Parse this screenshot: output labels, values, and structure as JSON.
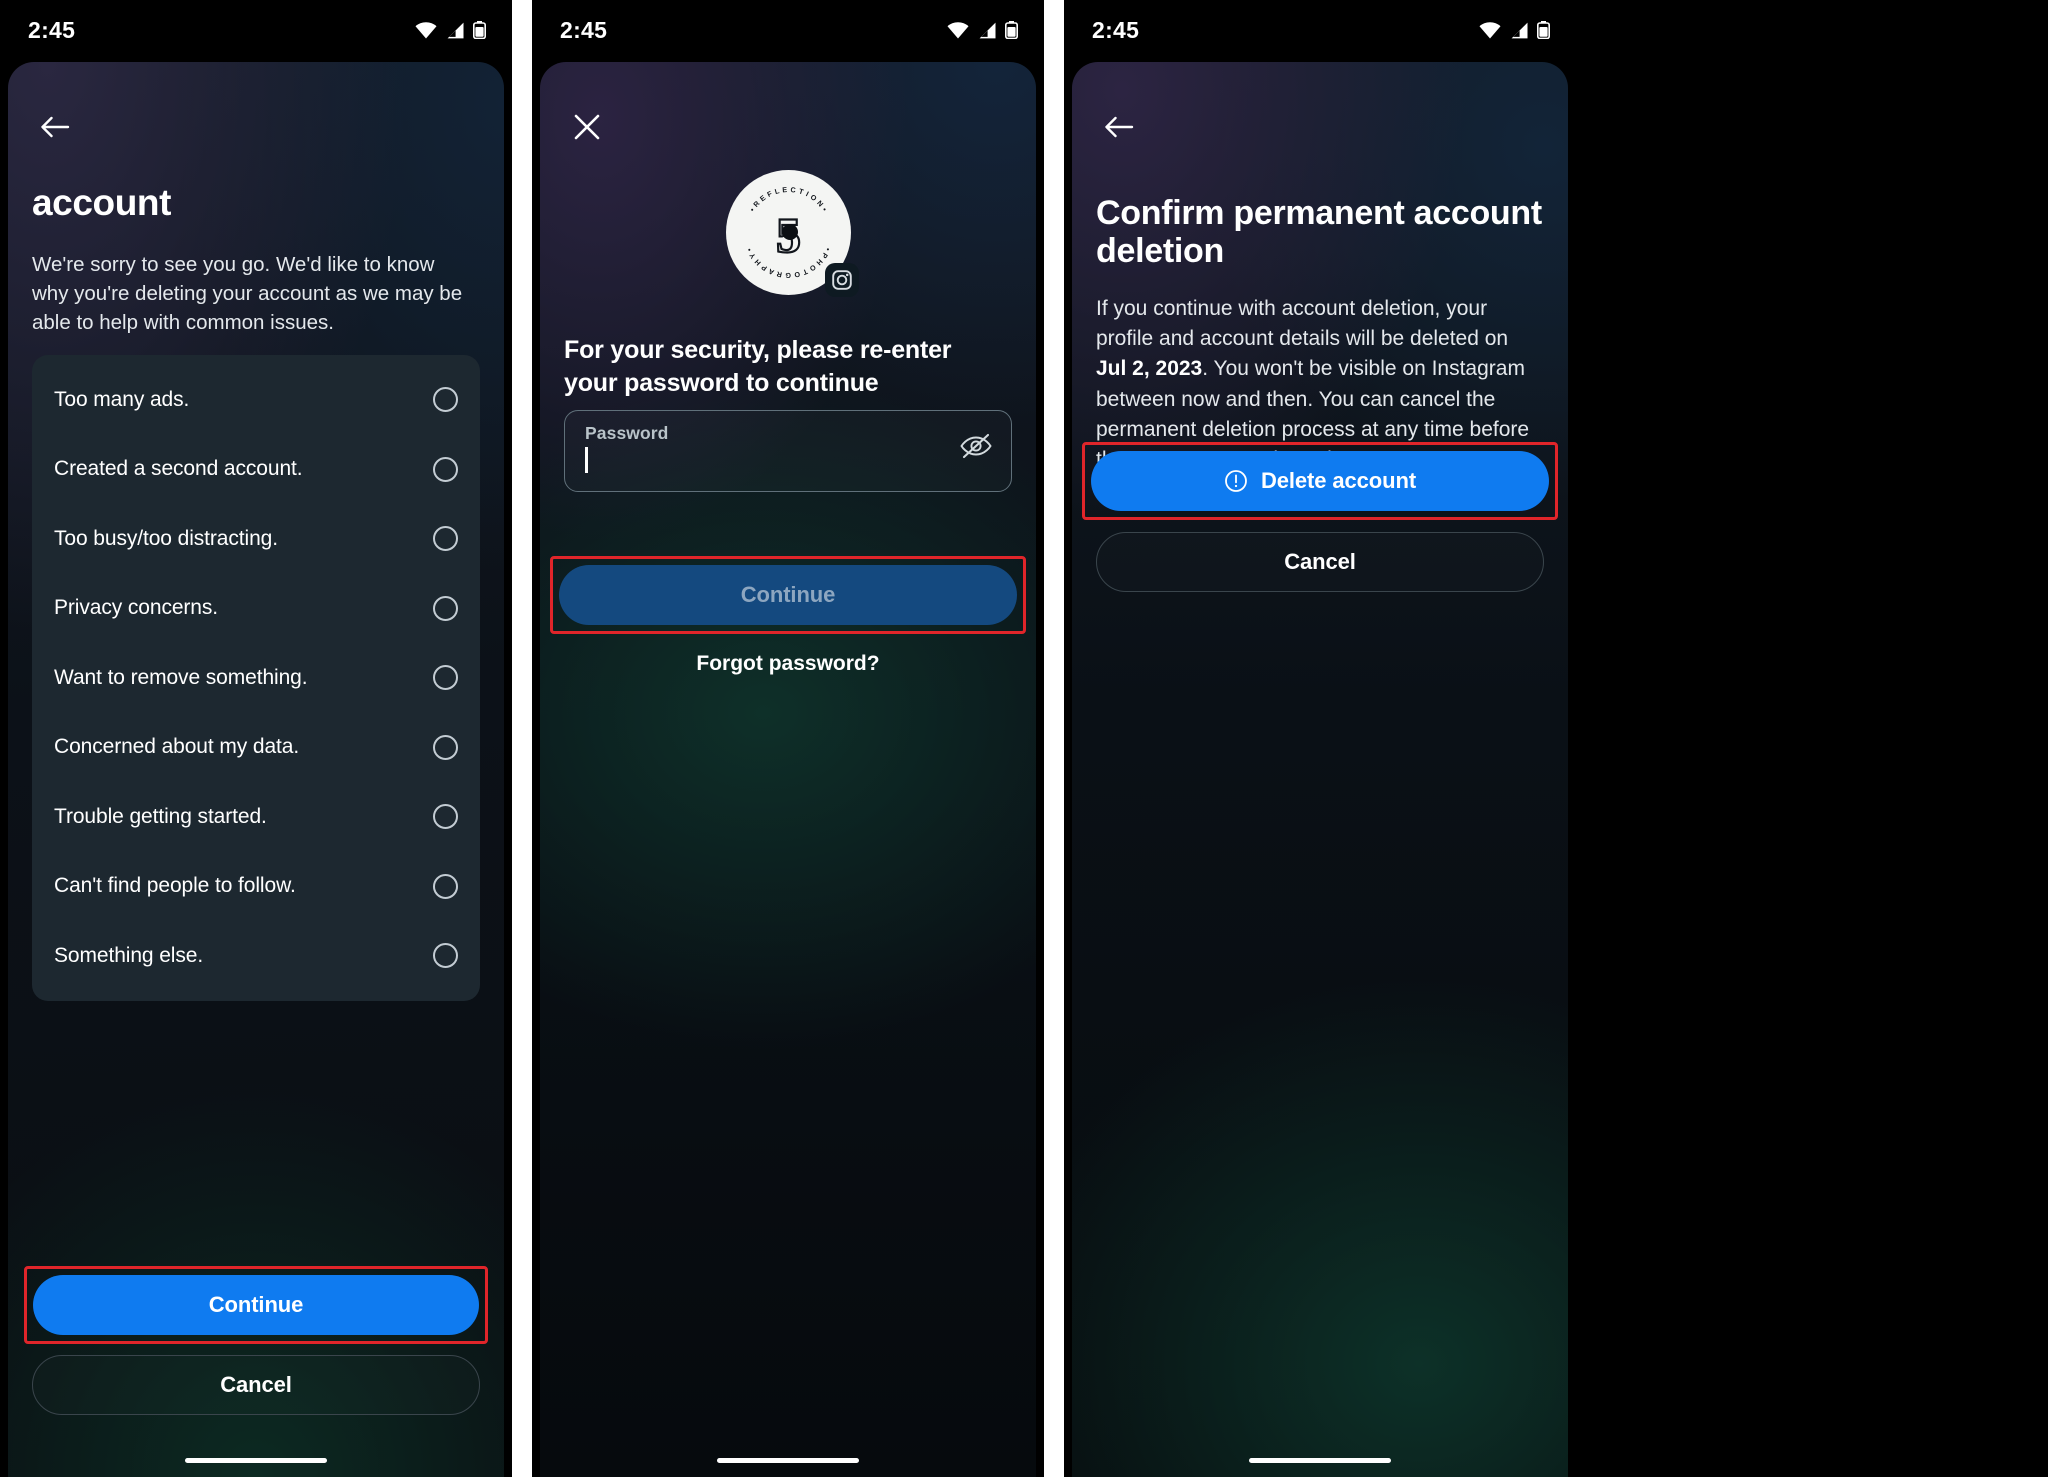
{
  "status_bar": {
    "time": "2:45",
    "icons": [
      "wifi-icon",
      "cellular-signal-icon",
      "battery-icon"
    ]
  },
  "colors": {
    "primary_blue": "#0f7bf0",
    "disabled_blue": "#14497f",
    "highlight_red": "#e0252a",
    "card_bg": "#1d2830",
    "text_primary": "#ffffff",
    "text_secondary": "#e4e8ec"
  },
  "panel1": {
    "back_icon": "arrow-left-icon",
    "title": "account",
    "description": "We're sorry to see you go. We'd like to know why you're deleting your account as we may be able to help with common issues.",
    "reasons": [
      "Too many ads.",
      "Created a second account.",
      "Too busy/too distracting.",
      "Privacy concerns.",
      "Want to remove something.",
      "Concerned about my data.",
      "Trouble getting started.",
      "Can't find people to follow.",
      "Something else."
    ],
    "continue_label": "Continue",
    "cancel_label": "Cancel",
    "continue_highlighted": true
  },
  "panel2": {
    "close_icon": "close-icon",
    "avatar": {
      "name": "profile-avatar",
      "center_text": "5",
      "ring_text_top": "REFLECTION",
      "ring_text_bottom": "PHOTOGRAPHY",
      "badge_icon": "instagram-icon"
    },
    "title": "For your security, please re-enter your password to continue",
    "password_field": {
      "label": "Password",
      "value": "",
      "placeholder": "Password",
      "toggle_icon": "eye-off-icon"
    },
    "continue_label": "Continue",
    "continue_disabled": true,
    "continue_highlighted": true,
    "forgot_password_label": "Forgot password?"
  },
  "panel3": {
    "back_icon": "arrow-left-icon",
    "title": "Confirm permanent account deletion",
    "body_part1": "If you continue with account deletion, your profile and account details will be deleted on ",
    "body_bold_date": "Jul 2, 2023",
    "body_part2": ". You won't be visible on Instagram between now and then. You can cancel the permanent deletion process at any time before the process starts through Accounts Center or by logging in to your Instagram account.",
    "delete_label": "Delete account",
    "delete_icon": "info-circle-icon",
    "delete_highlighted": true,
    "cancel_label": "Cancel"
  }
}
